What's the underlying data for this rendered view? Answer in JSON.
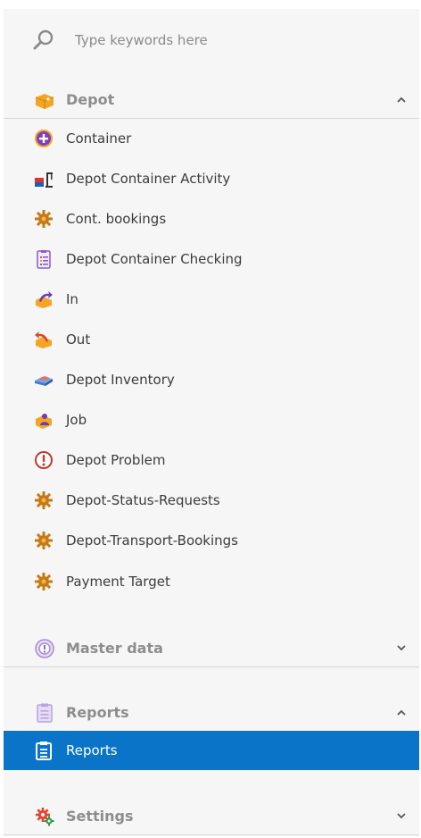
{
  "search": {
    "placeholder": "Type keywords here",
    "icon": "search-icon"
  },
  "groups": {
    "depot": {
      "label": "Depot",
      "icon": "depot-icon",
      "expanded": true,
      "items": [
        {
          "label": "Container",
          "icon": "container-add-icon"
        },
        {
          "label": "Depot Container Activity",
          "icon": "container-activity-icon"
        },
        {
          "label": "Cont. bookings",
          "icon": "gear-icon"
        },
        {
          "label": "Depot Container Checking",
          "icon": "checklist-icon"
        },
        {
          "label": "In",
          "icon": "in-arrow-icon"
        },
        {
          "label": "Out",
          "icon": "out-arrow-icon"
        },
        {
          "label": "Depot Inventory",
          "icon": "inventory-icon"
        },
        {
          "label": "Job",
          "icon": "job-icon"
        },
        {
          "label": "Depot Problem",
          "icon": "problem-icon"
        },
        {
          "label": "Depot-Status-Requests",
          "icon": "gear-icon"
        },
        {
          "label": "Depot-Transport-Bookings",
          "icon": "gear-icon"
        },
        {
          "label": "Payment Target",
          "icon": "gear-icon"
        }
      ]
    },
    "master_data": {
      "label": "Master data",
      "icon": "master-data-icon",
      "expanded": false
    },
    "reports": {
      "label": "Reports",
      "icon": "clipboard-icon",
      "expanded": true,
      "items": [
        {
          "label": "Reports",
          "icon": "clipboard-icon",
          "selected": true
        }
      ]
    },
    "settings": {
      "label": "Settings",
      "icon": "settings-icon",
      "expanded": false
    }
  },
  "colors": {
    "selected_bg": "#0a74c9",
    "panel_bg": "#f6f6f6",
    "group_label": "#8d8d8d"
  }
}
